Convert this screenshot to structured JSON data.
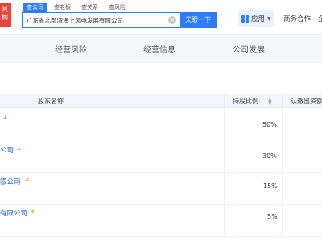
{
  "header": {
    "logo_lines": [
      "具",
      "构"
    ],
    "search_tabs": [
      {
        "label": "查公司",
        "active": true
      },
      {
        "label": "查老板",
        "active": false
      },
      {
        "label": "查关系",
        "active": false
      },
      {
        "label": "查风险",
        "active": false
      }
    ],
    "search_value": "广东省北部湾海上风电发展有限公司",
    "search_button": "天眼一下",
    "app_label": "应用",
    "business_link": "商务合作",
    "cut_link": "企"
  },
  "nav": {
    "items": [
      "经营风险",
      "经营信息",
      "公司发展"
    ]
  },
  "table": {
    "headers": {
      "name": "股东名称",
      "ratio": "持股比例",
      "capital": "认缴出资额"
    },
    "rows": [
      {
        "name": "",
        "ratio": "50%"
      },
      {
        "name": "公司",
        "ratio": "30%"
      },
      {
        "name": "限公司",
        "ratio": "15%"
      },
      {
        "name": "有限公司",
        "ratio": "5%"
      }
    ],
    "tag_glyph": "ቶ"
  },
  "colors": {
    "brand_red": "#e8453c",
    "accent_blue": "#2f7cf6",
    "link_blue": "#1a5fd6",
    "tag_orange": "#e08a1a"
  }
}
